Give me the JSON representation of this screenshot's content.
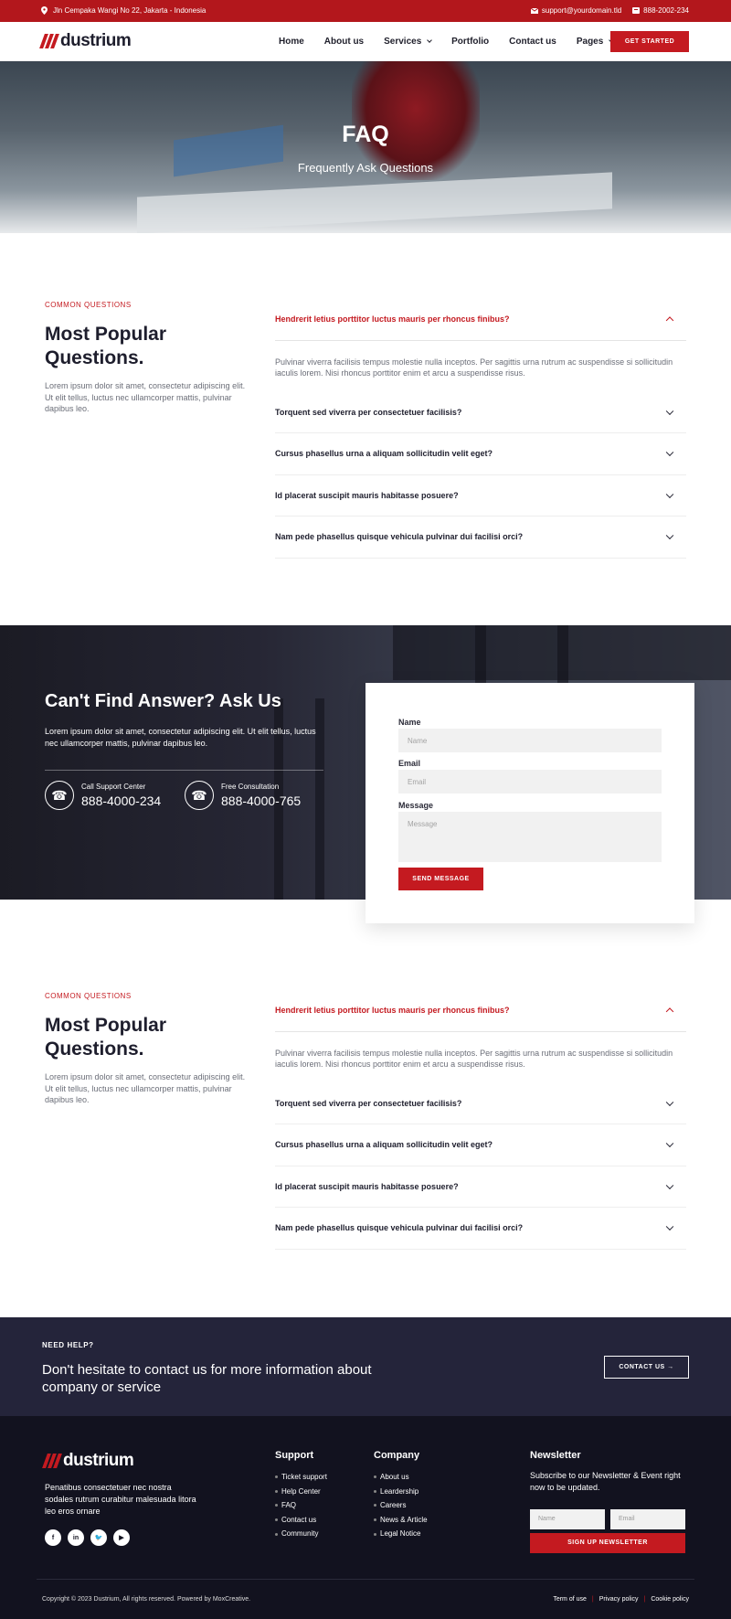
{
  "topbar": {
    "address": "Jln Cempaka Wangi No 22, Jakarta - Indonesia",
    "email": "support@yourdomain.tld",
    "phone": "888-2002-234"
  },
  "brand": {
    "name": "dustrium",
    "accent": "#c41a20"
  },
  "nav": {
    "items": [
      "Home",
      "About us",
      "Services",
      "Portfolio",
      "Contact us",
      "Pages"
    ],
    "cta": "GET STARTED"
  },
  "hero": {
    "title": "FAQ",
    "subtitle": "Frequently Ask Questions"
  },
  "faq": {
    "tag": "COMMON QUESTIONS",
    "title": "Most Popular Questions.",
    "desc": "Lorem ipsum dolor sit amet, consectetur adipiscing elit. Ut elit tellus, luctus nec ullamcorper mattis, pulvinar dapibus leo.",
    "open_question": "Hendrerit letius porttitor luctus mauris per rhoncus finibus?",
    "open_answer": "Pulvinar viverra facilisis tempus molestie nulla inceptos. Per sagittis urna rutrum ac suspendisse si sollicitudin iaculis lorem. Nisi rhoncus porttitor enim et arcu a suspendisse risus.",
    "questions": [
      "Torquent sed viverra per consectetuer facilisis?",
      "Cursus phasellus urna a aliquam sollicitudin velit eget?",
      "Id placerat suscipit mauris habitasse posuere?",
      "Nam pede phasellus quisque vehicula pulvinar dui facilisi orci?"
    ]
  },
  "contact": {
    "title": "Can't Find Answer? Ask Us",
    "desc": "Lorem ipsum dolor sit amet, consectetur adipiscing elit. Ut elit tellus, luctus nec ullamcorper mattis, pulvinar dapibus leo.",
    "support_label": "Call Support Center",
    "support_number": "888-4000-234",
    "consult_label": "Free Consultation",
    "consult_number": "888-4000-765",
    "form": {
      "name_label": "Name",
      "name_placeholder": "Name",
      "email_label": "Email",
      "email_placeholder": "Email",
      "message_label": "Message",
      "message_placeholder": "Message",
      "submit": "SEND MESSAGE"
    }
  },
  "help": {
    "tag": "NEED HELP?",
    "text": "Don't hesitate to contact us for more information about company or service",
    "button": "CONTACT US →"
  },
  "footer": {
    "about": "Penatibus consectetuer nec nostra sodales rutrum curabitur malesuada litora leo eros ornare",
    "support_title": "Support",
    "support_items": [
      "Ticket support",
      "Help Center",
      "FAQ",
      "Contact us",
      "Community"
    ],
    "company_title": "Company",
    "company_items": [
      "About us",
      "Leardership",
      "Careers",
      "News & Article",
      "Legal Notice"
    ],
    "newsletter_title": "Newsletter",
    "newsletter_text": "Subscribe to our Newsletter & Event right now to be updated.",
    "nl_name": "Name",
    "nl_email": "Email",
    "nl_button": "SIGN UP NEWSLETTER",
    "copyright": "Copyright © 2023 Dustrium, All rights reserved. Powered by MoxCreative.",
    "legal": [
      "Term of use",
      "Privacy policy",
      "Cookie policy"
    ]
  }
}
